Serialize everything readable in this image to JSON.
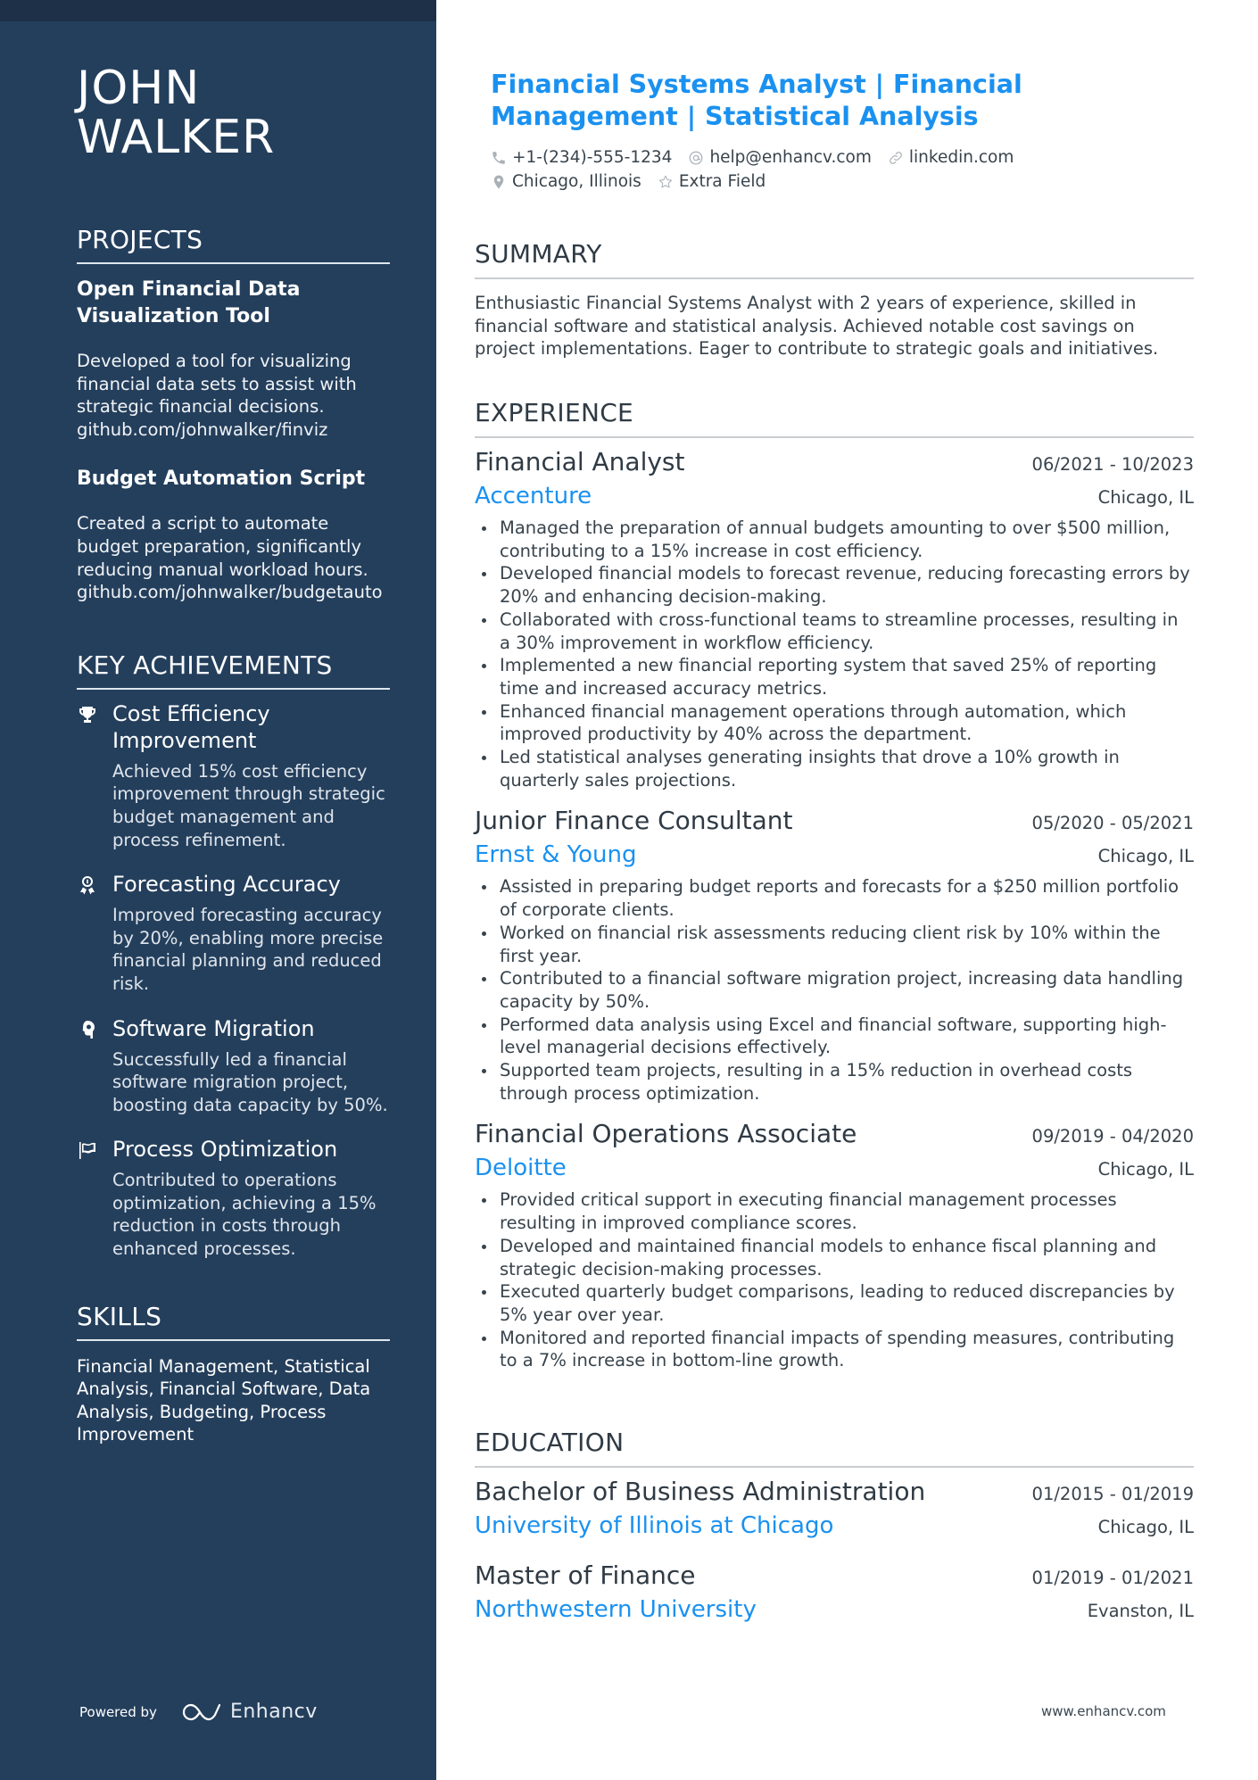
{
  "sidebar": {
    "name_line1": "JOHN",
    "name_line2": "WALKER",
    "projects": {
      "heading": "PROJECTS",
      "items": [
        {
          "title": "Open Financial Data Visualization Tool",
          "description": "Developed a tool for visualizing financial data sets to assist with strategic financial decisions. github.com/johnwalker/finviz"
        },
        {
          "title": "Budget Automation Script",
          "description": "Created a script to automate budget preparation, significantly reducing manual workload hours. github.com/johnwalker/budgetauto"
        }
      ]
    },
    "achievements": {
      "heading": "KEY ACHIEVEMENTS",
      "items": [
        {
          "icon": "trophy-icon",
          "title": "Cost Efficiency Improvement",
          "description": "Achieved 15% cost efficiency improvement through strategic budget management and process refinement."
        },
        {
          "icon": "award-ribbon-icon",
          "title": "Forecasting Accuracy",
          "description": "Improved forecasting accuracy by 20%, enabling more precise financial planning and reduced risk."
        },
        {
          "icon": "brain-head-icon",
          "title": "Software Migration",
          "description": "Successfully led a financial software migration project, boosting data capacity by 50%."
        },
        {
          "icon": "flag-icon",
          "title": "Process Optimization",
          "description": "Contributed to operations optimization, achieving a 15% reduction in costs through enhanced processes."
        }
      ]
    },
    "skills": {
      "heading": "SKILLS",
      "text": "Financial Management, Statistical Analysis, Financial Software, Data Analysis, Budgeting, Process Improvement"
    },
    "footer": {
      "powered_by": "Powered by",
      "brand": "Enhancv"
    }
  },
  "header": {
    "headline": "Financial Systems Analyst | Financial Management | Statistical Analysis",
    "contacts": {
      "phone": "+1-(234)-555-1234",
      "email": "help@enhancv.com",
      "link": "linkedin.com",
      "location": "Chicago, Illinois",
      "extra": "Extra Field"
    }
  },
  "summary": {
    "heading": "SUMMARY",
    "text": "Enthusiastic Financial Systems Analyst with 2 years of experience, skilled in financial software and statistical analysis. Achieved notable cost savings on project implementations. Eager to contribute to strategic goals and initiatives."
  },
  "experience": {
    "heading": "EXPERIENCE",
    "jobs": [
      {
        "role": "Financial Analyst",
        "dates": "06/2021 - 10/2023",
        "company": "Accenture",
        "location": "Chicago, IL",
        "bullets": [
          "Managed the preparation of annual budgets amounting to over $500 million, contributing to a 15% increase in cost efficiency.",
          "Developed financial models to forecast revenue, reducing forecasting errors by 20% and enhancing decision-making.",
          "Collaborated with cross-functional teams to streamline processes, resulting in a 30% improvement in workflow efficiency.",
          "Implemented a new financial reporting system that saved 25% of reporting time and increased accuracy metrics.",
          "Enhanced financial management operations through automation, which improved productivity by 40% across the department.",
          "Led statistical analyses generating insights that drove a 10% growth in quarterly sales projections."
        ]
      },
      {
        "role": "Junior Finance Consultant",
        "dates": "05/2020 - 05/2021",
        "company": "Ernst & Young",
        "location": "Chicago, IL",
        "bullets": [
          "Assisted in preparing budget reports and forecasts for a $250 million portfolio of corporate clients.",
          "Worked on financial risk assessments reducing client risk by 10% within the first year.",
          "Contributed to a financial software migration project, increasing data handling capacity by 50%.",
          "Performed data analysis using Excel and financial software, supporting high-level managerial decisions effectively.",
          "Supported team projects, resulting in a 15% reduction in overhead costs through process optimization."
        ]
      },
      {
        "role": "Financial Operations Associate",
        "dates": "09/2019 - 04/2020",
        "company": "Deloitte",
        "location": "Chicago, IL",
        "bullets": [
          "Provided critical support in executing financial management processes resulting in improved compliance scores.",
          "Developed and maintained financial models to enhance fiscal planning and strategic decision-making processes.",
          "Executed quarterly budget comparisons, leading to reduced discrepancies by 5% year over year.",
          "Monitored and reported financial impacts of spending measures, contributing to a 7% increase in bottom-line growth."
        ]
      }
    ]
  },
  "education": {
    "heading": "EDUCATION",
    "items": [
      {
        "degree": "Bachelor of Business Administration",
        "dates": "01/2015 - 01/2019",
        "school": "University of Illinois at Chicago",
        "location": "Chicago, IL"
      },
      {
        "degree": "Master of Finance",
        "dates": "01/2019 - 01/2021",
        "school": "Northwestern University",
        "location": "Evanston, IL"
      }
    ]
  },
  "footer": {
    "url": "www.enhancv.com"
  },
  "colors": {
    "sidebar_bg": "#243f5c",
    "sidebar_top_strip": "#1d3047",
    "accent": "#1a91f0",
    "text": "#2f3a44"
  }
}
